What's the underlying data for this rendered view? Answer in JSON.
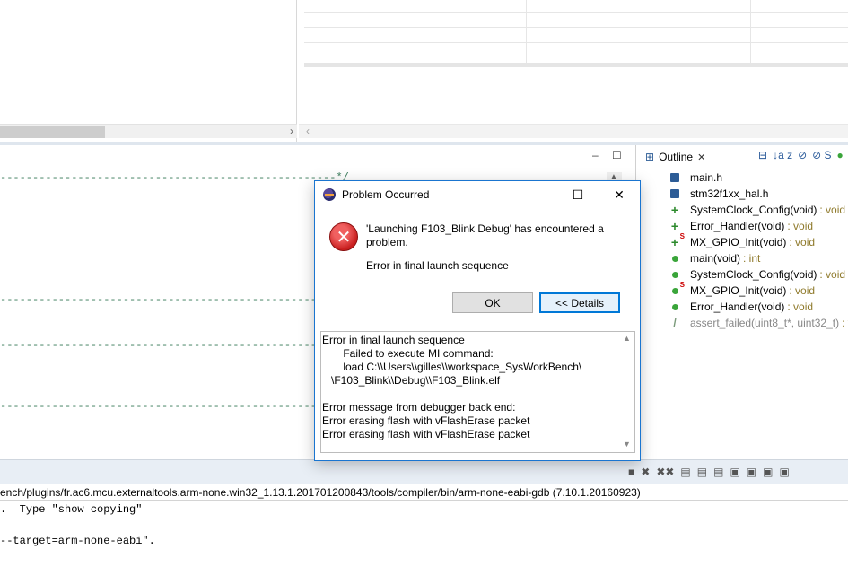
{
  "colors": {
    "comment": "#3f7f5f",
    "type": "#8f7a2c",
    "accent": "#0078d7",
    "error": "#c81e1e"
  },
  "top_left": {
    "scroll_right_icon": "chevron-right-icon",
    "scroll_right": "›"
  },
  "top_right": {
    "scroll_left": "‹"
  },
  "editor": {
    "minimize": "–",
    "maximize": "☐",
    "lines": [
      "----------------------------------------------------*/",
      "----------------------------------------------------*/",
      "----------------------------------------------------*/",
      "----------------------------------------------------*/"
    ]
  },
  "outline": {
    "tab_label": "Outline",
    "tab_close": "✕",
    "tools": [
      "⊟",
      "↓a z",
      "⊘",
      "⊘ S",
      "●"
    ],
    "items": [
      {
        "icon": "header",
        "name": "main.h",
        "type": ""
      },
      {
        "icon": "header",
        "name": "stm32f1xx_hal.h",
        "type": ""
      },
      {
        "icon": "decl",
        "name": "SystemClock_Config(void)",
        "type": ": void"
      },
      {
        "icon": "decl",
        "name": "Error_Handler(void)",
        "type": ": void"
      },
      {
        "icon": "decl-static",
        "name": "MX_GPIO_Init(void)",
        "type": ": void"
      },
      {
        "icon": "func",
        "name": "main(void)",
        "type": ": int"
      },
      {
        "icon": "func",
        "name": "SystemClock_Config(void)",
        "type": ": void"
      },
      {
        "icon": "func-static",
        "name": "MX_GPIO_Init(void)",
        "type": ": void"
      },
      {
        "icon": "func",
        "name": "Error_Handler(void)",
        "type": ": void"
      },
      {
        "icon": "assert",
        "name": "assert_failed(uint8_t*, uint32_t)",
        "type": ": v"
      }
    ]
  },
  "console": {
    "tools": [
      "■",
      "✖",
      "✖✖",
      "▤",
      "▤",
      "▤",
      "▣",
      "▣",
      "▣",
      "▣"
    ],
    "title": "ench/plugins/fr.ac6.mcu.externaltools.arm-none.win32_1.13.1.201701200843/tools/compiler/bin/arm-none-eabi-gdb (7.10.1.20160923)",
    "lines": [
      ".  Type \"show copying\"",
      "",
      "--target=arm-none-eabi\"."
    ]
  },
  "dialog": {
    "title": "Problem Occurred",
    "minimize": "—",
    "maximize": "☐",
    "close": "✕",
    "message": "'Launching F103_Blink Debug' has encountered a problem.",
    "reason": "Error in final launch sequence",
    "ok_label": "OK",
    "details_label": "<< Details",
    "details_text": "Error in final launch sequence\n       Failed to execute MI command:\n       load C:\\\\Users\\\\gilles\\\\workspace_SysWorkBench\\\n   \\F103_Blink\\\\Debug\\\\F103_Blink.elf\n\nError message from debugger back end:\nError erasing flash with vFlashErase packet\nError erasing flash with vFlashErase packet",
    "scroll_up": "▲",
    "scroll_down": "▼"
  }
}
